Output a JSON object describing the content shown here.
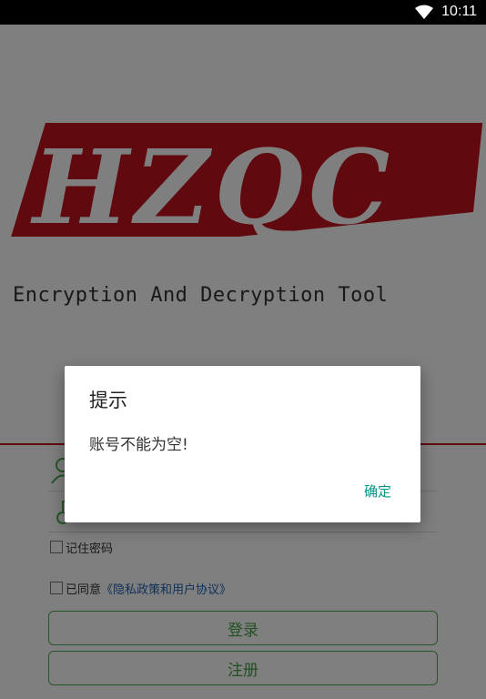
{
  "status_bar": {
    "time": "10:11",
    "wifi_icon": "wifi-icon"
  },
  "logo": {
    "letters": "HZQC",
    "tagline": "Encryption And Decryption Tool",
    "brand_color": "#c0121c"
  },
  "login": {
    "username_icon": "user-icon",
    "password_icon": "lock-icon",
    "remember_label": "记住密码",
    "agree_label": "已同意",
    "agree_link": "《隐私政策和用户协议》",
    "login_button": "登录",
    "register_button": "注册",
    "accent_color": "#4caf50"
  },
  "dialog": {
    "title": "提示",
    "message": "账号不能为空!",
    "confirm_button": "确定",
    "button_color": "#009688"
  }
}
